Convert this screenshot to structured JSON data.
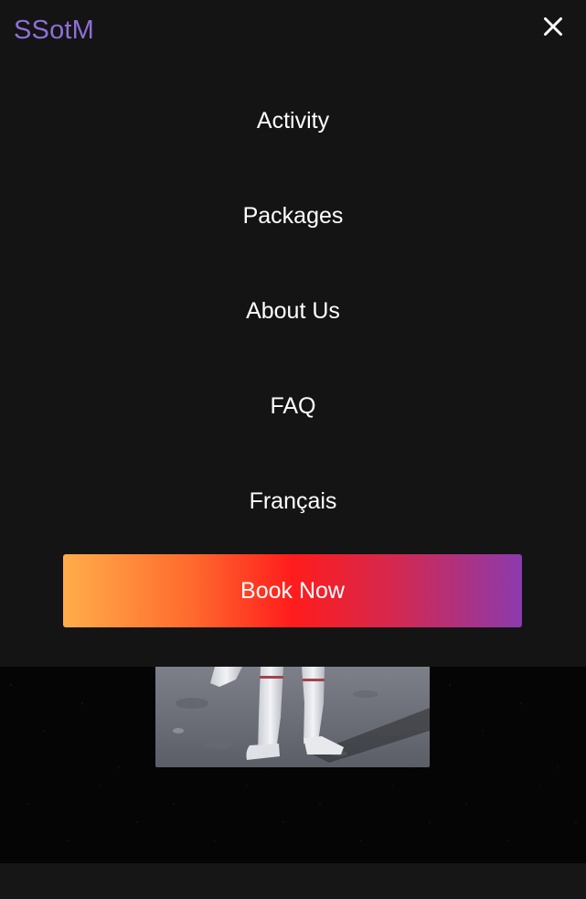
{
  "brand": {
    "name": "SSotM",
    "color": "#8f6fd6"
  },
  "menu": {
    "close_icon": "close-icon",
    "items": [
      {
        "label": "Activity"
      },
      {
        "label": "Packages"
      },
      {
        "label": "About Us"
      },
      {
        "label": "FAQ"
      },
      {
        "label": "Français"
      }
    ],
    "cta_label": "Book Now"
  },
  "colors": {
    "menu_background": "#141414",
    "cta_gradient": [
      "#ffad4a",
      "#ff1c1c",
      "#8b3aad"
    ],
    "text": "#ffffff"
  },
  "hero_image": {
    "subject": "astronaut-on-moon-image"
  }
}
